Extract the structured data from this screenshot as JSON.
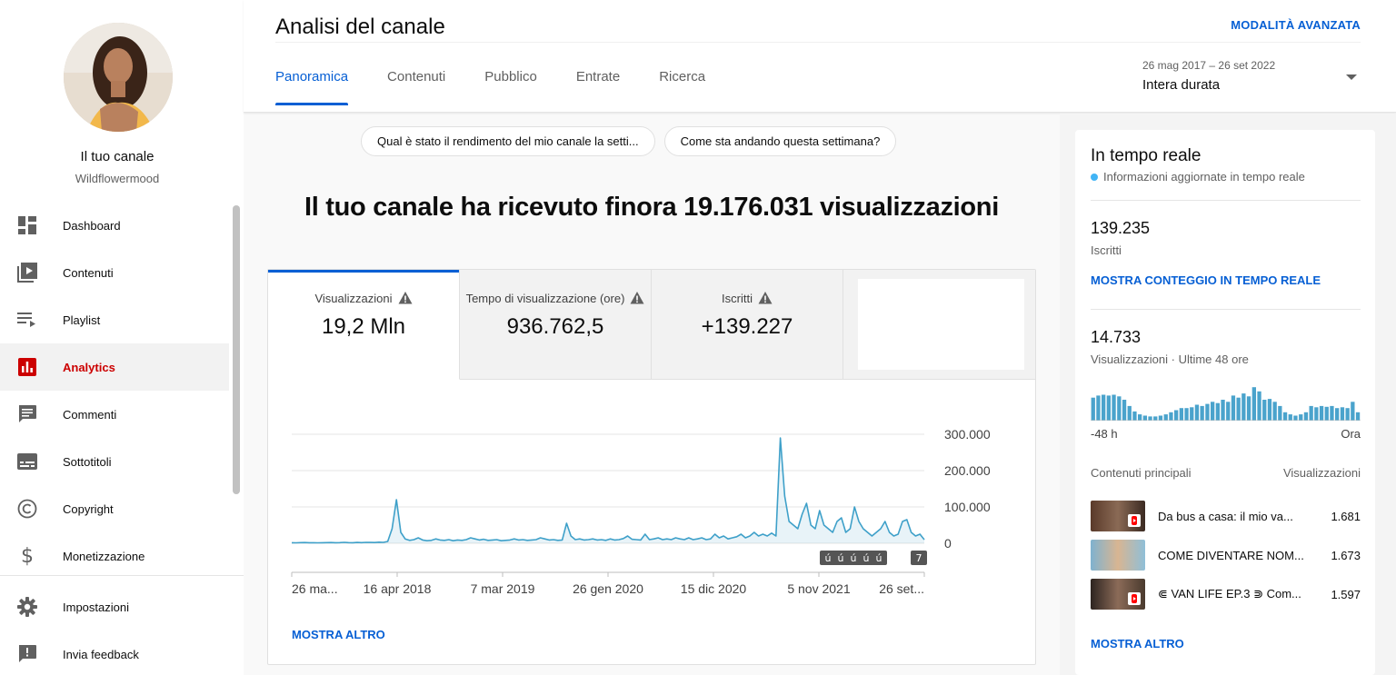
{
  "sidebar": {
    "channel_title": "Il tuo canale",
    "channel_handle": "Wildflowermood",
    "items": [
      {
        "label": "Dashboard",
        "icon": "dashboard-icon"
      },
      {
        "label": "Contenuti",
        "icon": "content-icon"
      },
      {
        "label": "Playlist",
        "icon": "playlist-icon"
      },
      {
        "label": "Analytics",
        "icon": "analytics-icon",
        "active": true
      },
      {
        "label": "Commenti",
        "icon": "comments-icon"
      },
      {
        "label": "Sottotitoli",
        "icon": "subtitles-icon"
      },
      {
        "label": "Copyright",
        "icon": "copyright-icon"
      },
      {
        "label": "Monetizzazione",
        "icon": "monetization-icon"
      }
    ],
    "bottom_items": [
      {
        "label": "Impostazioni",
        "icon": "settings-icon"
      },
      {
        "label": "Invia feedback",
        "icon": "feedback-icon"
      }
    ]
  },
  "header": {
    "title": "Analisi del canale",
    "advanced_mode": "MODALITÀ AVANZATA",
    "tabs": [
      "Panoramica",
      "Contenuti",
      "Pubblico",
      "Entrate",
      "Ricerca"
    ],
    "active_tab": "Panoramica",
    "date_range": "26 mag 2017 – 26 set 2022",
    "period": "Intera durata"
  },
  "chips": [
    "Qual è stato il rendimento del mio canale la setti...",
    "Come sta andando questa settimana?"
  ],
  "headline": "Il tuo canale ha ricevuto finora 19.176.031 visualizzazioni",
  "metrics": [
    {
      "label": "Visualizzazioni",
      "value": "19,2 Mln",
      "warning": true,
      "active": true
    },
    {
      "label": "Tempo di visualizzazione (ore)",
      "value": "936.762,5",
      "warning": true
    },
    {
      "label": "Iscritti",
      "value": "+139.227",
      "warning": true
    }
  ],
  "chart_data": {
    "type": "line",
    "series": [
      {
        "values": [
          1500,
          1200,
          1800,
          2000,
          1500,
          1400,
          1300,
          1600,
          1800,
          2000,
          1500,
          1700,
          2500,
          1800,
          1500,
          2200,
          1800,
          2500,
          2200,
          2000,
          3000,
          2500,
          5000,
          40000,
          120000,
          30000,
          12000,
          8000,
          10000,
          15000,
          9000,
          7000,
          8000,
          12000,
          9000,
          8000,
          10000,
          7000,
          9000,
          8000,
          10000,
          15000,
          12000,
          9000,
          11000,
          8000,
          9000,
          10000,
          7000,
          8000,
          9000,
          12000,
          9000,
          10000,
          8000,
          9000,
          10000,
          15000,
          12000,
          9000,
          10000,
          8000,
          9000,
          55000,
          20000,
          10000,
          12000,
          9000,
          10000,
          12000,
          9000,
          10000,
          8000,
          12000,
          9000,
          10000,
          13000,
          20000,
          11000,
          10000,
          9000,
          25000,
          10000,
          12000,
          15000,
          10000,
          12000,
          10000,
          15000,
          12000,
          10000,
          15000,
          10000,
          12000,
          15000,
          10000,
          12000,
          25000,
          15000,
          20000,
          12000,
          15000,
          18000,
          25000,
          15000,
          20000,
          30000,
          20000,
          25000,
          20000,
          28000,
          20000,
          290000,
          130000,
          60000,
          50000,
          40000,
          80000,
          110000,
          50000,
          40000,
          90000,
          50000,
          40000,
          30000,
          60000,
          70000,
          30000,
          40000,
          100000,
          60000,
          40000,
          30000,
          20000,
          30000,
          40000,
          60000,
          30000,
          20000,
          25000,
          60000,
          65000,
          30000,
          20000,
          25000,
          10000
        ]
      }
    ],
    "x_tick_labels": [
      "26 ma...",
      "16 apr 2018",
      "7 mar 2019",
      "26 gen 2020",
      "15 dic 2020",
      "5 nov 2021",
      "26 set..."
    ],
    "y_tick_labels": [
      "300.000",
      "200.000",
      "100.000",
      "0"
    ],
    "ylim": [
      0,
      300000
    ],
    "annotation_badges": [
      "ú",
      "ú",
      "ú",
      "ú",
      "ú",
      "7"
    ]
  },
  "show_more": "MOSTRA ALTRO",
  "realtime": {
    "title": "In tempo reale",
    "subtitle": "Informazioni aggiornate in tempo reale",
    "subscribers_value": "139.235",
    "subscribers_label": "Iscritti",
    "show_live_count": "MOSTRA CONTEGGIO IN TEMPO REALE",
    "views_value": "14.733",
    "views_label": "Visualizzazioni · Ultime 48 ore",
    "axis_left": "-48 h",
    "axis_right": "Ora",
    "bars": [
      0.55,
      0.6,
      0.62,
      0.6,
      0.62,
      0.58,
      0.5,
      0.35,
      0.22,
      0.15,
      0.12,
      0.1,
      0.1,
      0.12,
      0.15,
      0.2,
      0.25,
      0.3,
      0.3,
      0.32,
      0.38,
      0.35,
      0.4,
      0.45,
      0.42,
      0.5,
      0.45,
      0.6,
      0.55,
      0.65,
      0.58,
      0.8,
      0.7,
      0.5,
      0.52,
      0.45,
      0.35,
      0.2,
      0.15,
      0.12,
      0.15,
      0.2,
      0.35,
      0.32,
      0.35,
      0.33,
      0.35,
      0.3,
      0.32,
      0.3,
      0.45,
      0.2
    ],
    "top_content_header": "Contenuti principali",
    "views_header": "Visualizzazioni",
    "top_content": [
      {
        "title": "Da bus a casa: il mio va...",
        "views": "1.681"
      },
      {
        "title": "COME DIVENTARE NOM...",
        "views": "1.673"
      },
      {
        "title": "⋐ VAN LIFE EP.3 ⋑ Com...",
        "views": "1.597"
      }
    ],
    "show_more": "MOSTRA ALTRO"
  },
  "colors": {
    "accent": "#065fd4",
    "analytics_red": "#cc0000",
    "chart_line": "#3ea0c9",
    "realtime_bar": "#4aa3cc"
  }
}
